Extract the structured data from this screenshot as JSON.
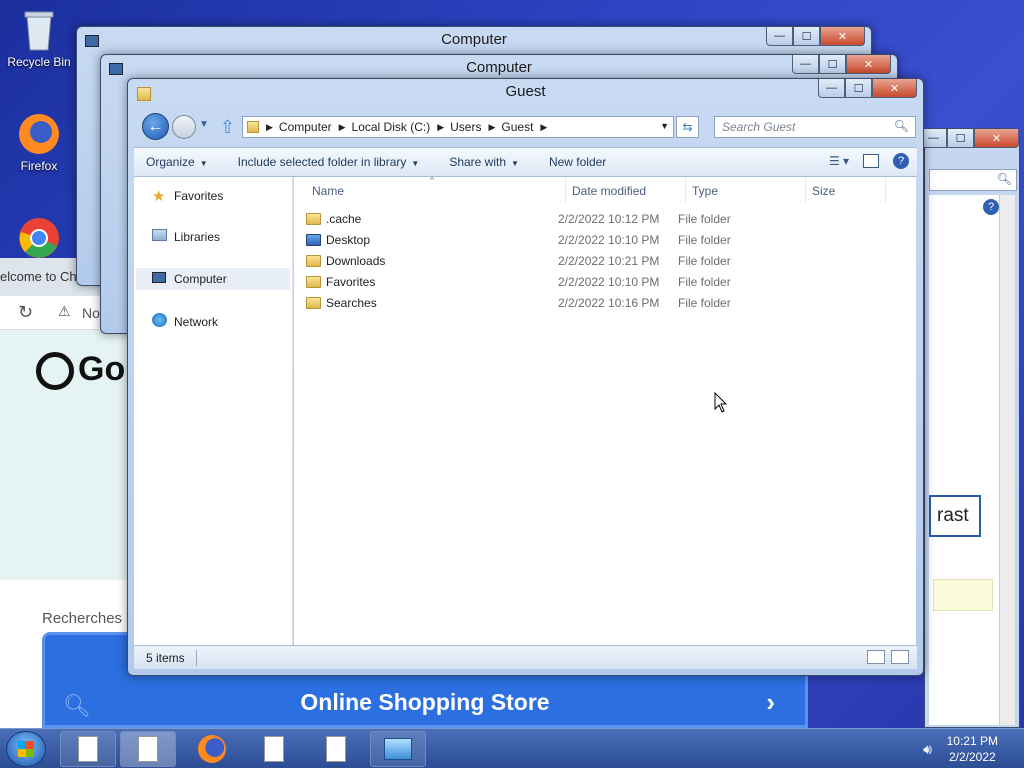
{
  "desktop": {
    "icons": [
      {
        "label": "Recycle Bin"
      },
      {
        "label": "Firefox"
      }
    ]
  },
  "windows": {
    "back1_title": "Computer",
    "back2_title": "Computer",
    "main_title": "Guest"
  },
  "chrome": {
    "tab_label": "elcome to Chrome",
    "addr_text": "Not sec",
    "heading": "Go",
    "recherches": "Recherches",
    "banner_text": "Online Shopping Store"
  },
  "right_window": {
    "button_text": "rast"
  },
  "explorer": {
    "breadcrumb": [
      "Computer",
      "Local Disk (C:)",
      "Users",
      "Guest"
    ],
    "search_placeholder": "Search Guest",
    "toolbar": {
      "organize": "Organize",
      "include": "Include selected folder in library",
      "share": "Share with",
      "new_folder": "New folder"
    },
    "nav": {
      "favorites": "Favorites",
      "libraries": "Libraries",
      "computer": "Computer",
      "network": "Network"
    },
    "columns": {
      "name": "Name",
      "date": "Date modified",
      "type": "Type",
      "size": "Size"
    },
    "files": [
      {
        "name": ".cache",
        "date": "2/2/2022 10:12 PM",
        "type": "File folder"
      },
      {
        "name": "Desktop",
        "date": "2/2/2022 10:10 PM",
        "type": "File folder"
      },
      {
        "name": "Downloads",
        "date": "2/2/2022 10:21 PM",
        "type": "File folder"
      },
      {
        "name": "Favorites",
        "date": "2/2/2022 10:10 PM",
        "type": "File folder"
      },
      {
        "name": "Searches",
        "date": "2/2/2022 10:16 PM",
        "type": "File folder"
      }
    ],
    "status": "5 items"
  },
  "taskbar": {
    "time": "10:21 PM",
    "date": "2/2/2022"
  }
}
